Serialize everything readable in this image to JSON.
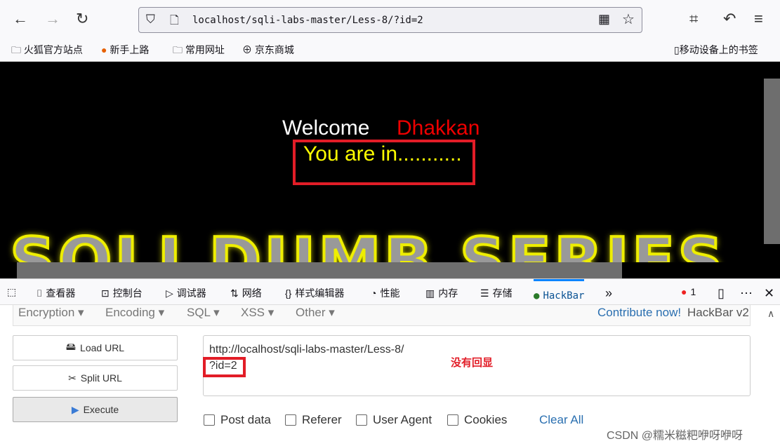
{
  "browser": {
    "url": "localhost/sqli-labs-master/Less-8/?id=2"
  },
  "bookmarks": [
    "火狐官方站点",
    "新手上路",
    "常用网址",
    "京东商城"
  ],
  "mobile_bookmarks": "移动设备上的书签",
  "page": {
    "welcome": "Welcome",
    "name": "Dhakkan",
    "message": "You are in...........",
    "banner": "SQLI DUMB SERIES"
  },
  "devtools": {
    "tabs": [
      "查看器",
      "控制台",
      "调试器",
      "网络",
      "样式编辑器",
      "性能",
      "内存",
      "存储",
      "HackBar"
    ],
    "error_count": "1"
  },
  "hackbar": {
    "menu": [
      "Encryption",
      "Encoding",
      "SQL",
      "XSS",
      "Other"
    ],
    "contribute": "Contribute now!",
    "version": "HackBar v2",
    "buttons": [
      "Load URL",
      "Split URL",
      "Execute"
    ],
    "url_line1": "http://localhost/sqli-labs-master/Less-8/",
    "url_line2": "?id=2",
    "annotation": "没有回显",
    "checkboxes": [
      "Post data",
      "Referer",
      "User Agent",
      "Cookies"
    ],
    "clear_all": "Clear All"
  },
  "watermark": "CSDN @糯米糍粑咿呀咿呀"
}
